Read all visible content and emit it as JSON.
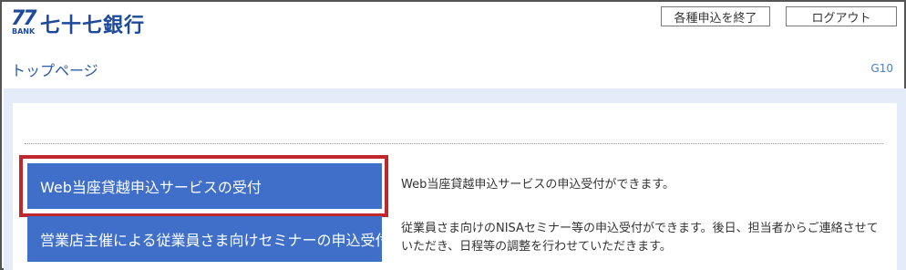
{
  "header": {
    "logo_number": "77",
    "logo_sub": "BANK",
    "bank_name": "七十七銀行",
    "end_button": "各種申込を終了",
    "logout_button": "ログアウト"
  },
  "page": {
    "title": "トップページ",
    "code": "G10"
  },
  "services": [
    {
      "label": "Web当座貸越申込サービスの受付",
      "description": "Web当座貸越申込サービスの申込受付ができます。"
    },
    {
      "label": "営業店主催による従業員さま向けセミナーの申込受付",
      "description": "従業員さま向けのNISAセミナー等の申込受付ができます。後日、担当者からご連絡させていただき、日程等の調整を行わせていただきます。"
    }
  ],
  "colors": {
    "brand": "#1d4a9a",
    "button": "#3f6fc9",
    "highlight": "#c0272c",
    "band": "#e3ecf8"
  }
}
